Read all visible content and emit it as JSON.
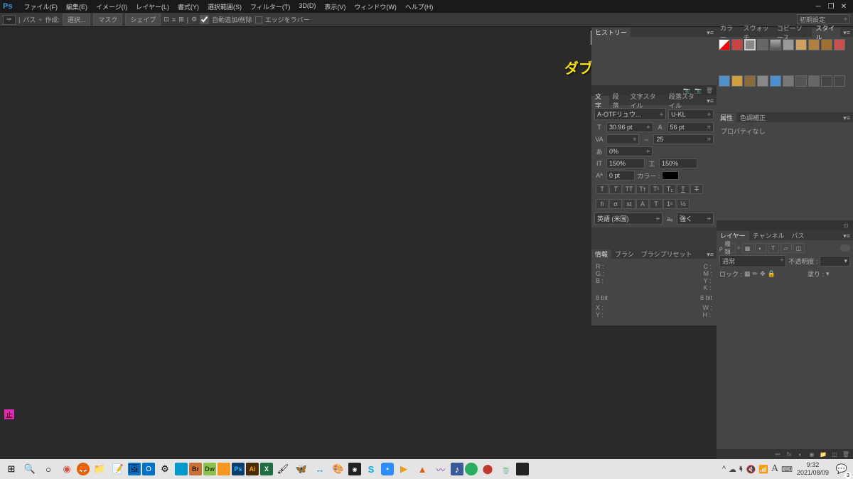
{
  "app": {
    "logo": "Ps"
  },
  "menubar": [
    "ファイル(F)",
    "編集(E)",
    "イメージ(I)",
    "レイヤー(L)",
    "書式(Y)",
    "選択範囲(S)",
    "フィルター(T)",
    "3D(D)",
    "表示(V)",
    "ウィンドウ(W)",
    "ヘルプ(H)"
  ],
  "workspace": "初期設定",
  "optionsbar": {
    "path_label": "パス",
    "create": "作成:",
    "select": "選択...",
    "mask": "マスク",
    "shape": "シェイプ",
    "auto_add_delete_checked": true,
    "auto_add_delete": "自動追加/削除",
    "rubber": "エッジをラバー"
  },
  "annotation": "ダブルクリック",
  "history_panel": {
    "tab": "ヒストリー"
  },
  "styles_panel": {
    "tabs": [
      "カラー",
      "スウォッチ",
      "コピーソース",
      "スタイル"
    ],
    "active": 3,
    "swatches": [
      "#000",
      "#c44",
      "#888",
      "#666",
      "#aaa",
      "#999",
      "#d0a060",
      "#b08040",
      "#b0803b",
      "#c85050",
      "#5090c8",
      "#d0a040",
      "#8a6a3b",
      "#888",
      "#4a90d0",
      "#777",
      "#555",
      "#666"
    ]
  },
  "properties_panel": {
    "tabs": [
      "属性",
      "色調補正"
    ],
    "active": 0,
    "body": "プロパティなし"
  },
  "character_panel": {
    "tabs": [
      "文字",
      "段落",
      "文字スタイル",
      "段落スタイル"
    ],
    "active": 0,
    "font": "A-OTFリュウ...",
    "style": "U-KL",
    "size": "30.96 pt",
    "leading": "56 pt",
    "va": "VA",
    "tracking": "25",
    "aa": "0%",
    "scale_h": "150%",
    "scale_v": "150%",
    "baseline": "0 pt",
    "color_label": "カラー :",
    "lang": "英語 (米国)",
    "sharp": "強く"
  },
  "info_panel": {
    "tabs": [
      "情報",
      "ブラシ",
      "ブラシプリセット"
    ],
    "active": 0,
    "rgb": {
      "R": "R :",
      "G": "G :",
      "B": "B :"
    },
    "cmyk": {
      "C": "C :",
      "M": "M :",
      "Y": "Y :",
      "K": "K :"
    },
    "bit1": "8 bit",
    "bit2": "8 bit",
    "xy": {
      "X": "X :",
      "Y": "Y :"
    },
    "wh": {
      "W": "W :",
      "H": "H :"
    }
  },
  "layers_panel": {
    "tabs": [
      "レイヤー",
      "チャンネル",
      "パス"
    ],
    "active": 0,
    "kind": "種類",
    "blend": "通常",
    "opacity_label": "不透明度 :",
    "lock_label": "ロック :",
    "fill_label": "塗り :"
  },
  "stop_text": "止",
  "taskbar": {
    "clock_time": "9:32",
    "clock_date": "2021/08/09",
    "notif": "3"
  }
}
